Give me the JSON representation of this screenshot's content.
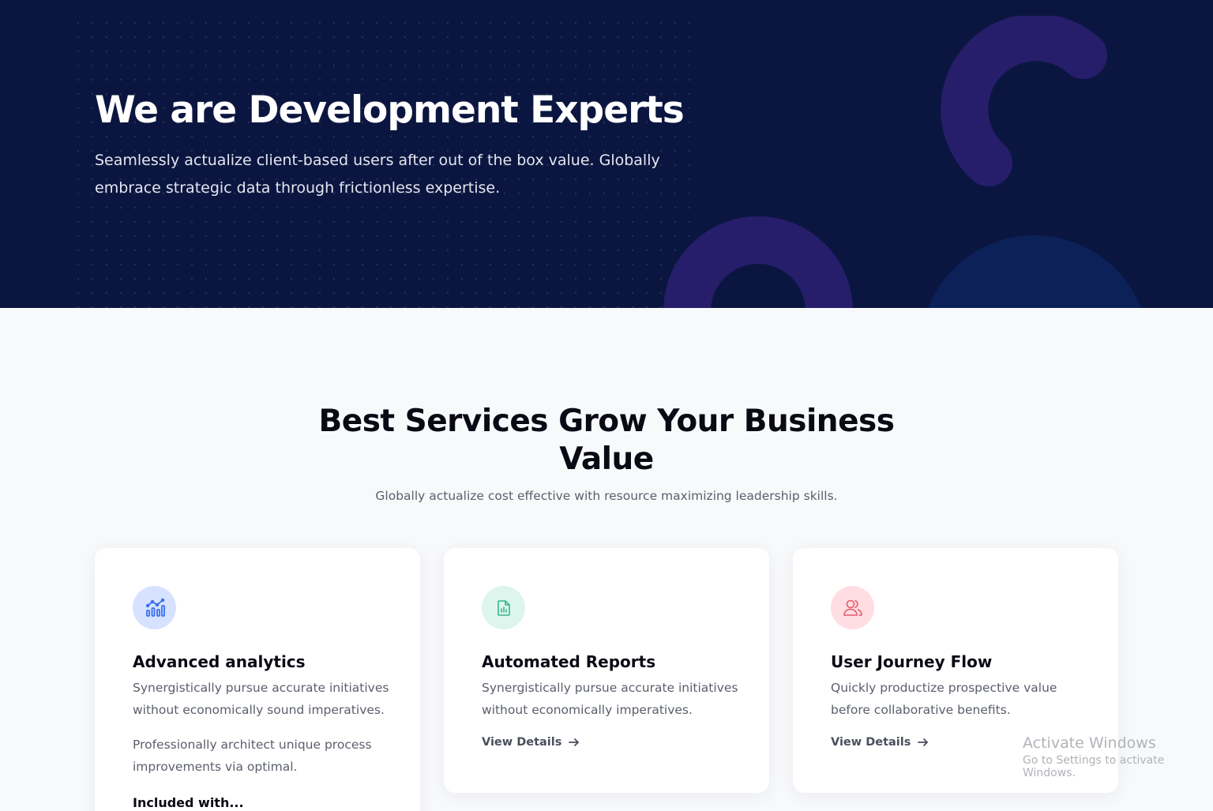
{
  "hero": {
    "title": "We are Development Experts",
    "subtitle": "Seamlessly actualize client-based users after out of the box value. Globally embrace strategic data through frictionless expertise."
  },
  "services": {
    "title": "Best Services Grow Your Business Value",
    "subtitle": "Globally actualize cost effective with resource maximizing leadership skills.",
    "cards": [
      {
        "icon": "analytics-chart-icon",
        "icon_bg": "#d6e2ff",
        "icon_color": "#3b6ef0",
        "title": "Advanced analytics",
        "text1": "Synergistically pursue accurate initiatives without economically sound imperatives.",
        "text2": "Professionally architect unique process improvements via optimal.",
        "subhead": "Included with..."
      },
      {
        "icon": "report-document-icon",
        "icon_bg": "#ddf5ec",
        "icon_color": "#35b58a",
        "title": "Automated Reports",
        "text1": "Synergistically pursue accurate initiatives without economically imperatives.",
        "link": "View Details"
      },
      {
        "icon": "users-icon",
        "icon_bg": "#ffdde2",
        "icon_color": "#e35b6e",
        "title": "User Journey Flow",
        "text1": "Quickly productize prospective value before collaborative benefits.",
        "link": "View Details"
      }
    ]
  },
  "watermark": {
    "line1": "Activate Windows",
    "line2": "Go to Settings to activate Windows."
  },
  "colors": {
    "hero_bg": "#0b1640",
    "shape_purple": "#261e6b",
    "shape_navy": "#0c2157"
  }
}
